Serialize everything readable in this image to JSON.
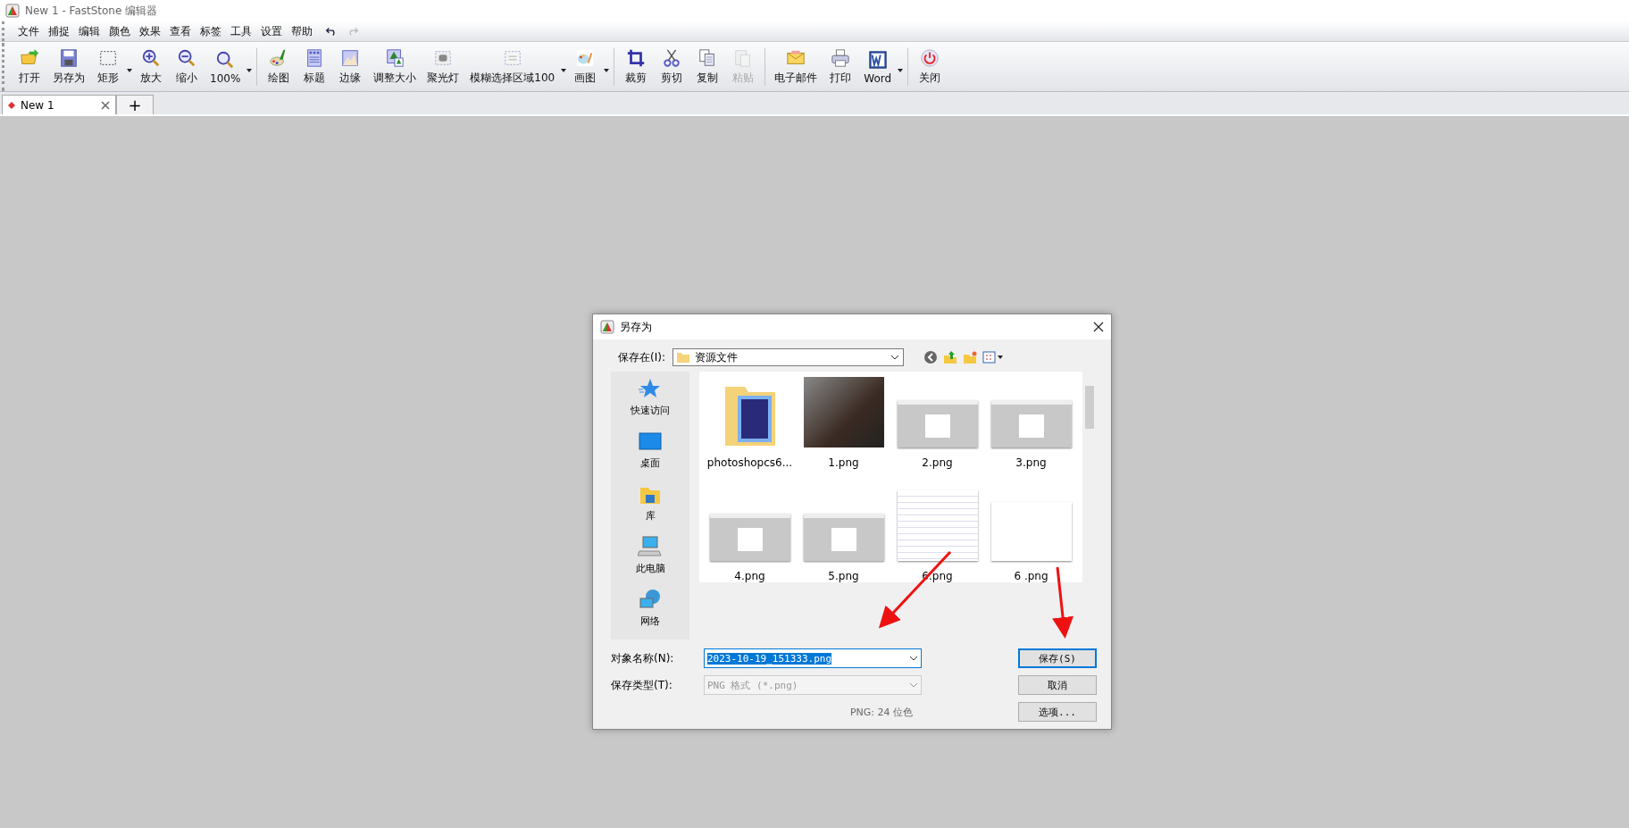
{
  "window": {
    "title": "New 1 - FastStone 编辑器"
  },
  "menu": [
    {
      "label": "文件"
    },
    {
      "label": "捕捉"
    },
    {
      "label": "编辑"
    },
    {
      "label": "颜色"
    },
    {
      "label": "效果"
    },
    {
      "label": "查看"
    },
    {
      "label": "标签"
    },
    {
      "label": "工具"
    },
    {
      "label": "设置"
    },
    {
      "label": "帮助"
    }
  ],
  "history": [
    {
      "kind": "undo",
      "disabled": false
    },
    {
      "kind": "redo",
      "disabled": true
    }
  ],
  "toolbar": [
    {
      "label": "打开",
      "dropdown": false,
      "disabled": false
    },
    {
      "label": "另存为",
      "dropdown": false,
      "disabled": false
    },
    {
      "label": "矩形",
      "dropdown": true,
      "disabled": false
    },
    {
      "label": "放大",
      "dropdown": false,
      "disabled": false
    },
    {
      "label": "缩小",
      "dropdown": false,
      "disabled": false
    },
    {
      "label": "100%",
      "dropdown": true,
      "disabled": false
    },
    {
      "label": "绘图",
      "dropdown": false,
      "disabled": false
    },
    {
      "label": "标题",
      "dropdown": false,
      "disabled": false
    },
    {
      "label": "边缘",
      "dropdown": false,
      "disabled": false
    },
    {
      "label": "调整大小",
      "dropdown": false,
      "disabled": false
    },
    {
      "label": "聚光灯",
      "dropdown": false,
      "disabled": false
    },
    {
      "label": "模糊选择区域100",
      "dropdown": true,
      "disabled": false
    },
    {
      "label": "画图",
      "dropdown": true,
      "disabled": false
    },
    {
      "label": "裁剪",
      "dropdown": false,
      "disabled": false
    },
    {
      "label": "剪切",
      "dropdown": false,
      "disabled": false
    },
    {
      "label": "复制",
      "dropdown": false,
      "disabled": false
    },
    {
      "label": "粘贴",
      "dropdown": false,
      "disabled": true
    },
    {
      "label": "电子邮件",
      "dropdown": false,
      "disabled": false
    },
    {
      "label": "打印",
      "dropdown": false,
      "disabled": false
    },
    {
      "label": "Word",
      "dropdown": true,
      "disabled": false
    },
    {
      "label": "关闭",
      "dropdown": false,
      "disabled": false
    }
  ],
  "tabs": [
    {
      "label": "New 1",
      "selected": true
    }
  ],
  "new_tab": "+",
  "dialog": {
    "title": "另存为",
    "save_in_label": "保存在(I):",
    "save_in_value": "资源文件",
    "places": [
      {
        "label": "快速访问"
      },
      {
        "label": "桌面"
      },
      {
        "label": "库"
      },
      {
        "label": "此电脑"
      },
      {
        "label": "网络"
      }
    ],
    "files": [
      {
        "name": "photoshopcs6...",
        "kind": "folder"
      },
      {
        "name": "1.png",
        "kind": "photo"
      },
      {
        "name": "2.png",
        "kind": "screen"
      },
      {
        "name": "3.png",
        "kind": "screen"
      },
      {
        "name": "4.png",
        "kind": "screen"
      },
      {
        "name": "5.png",
        "kind": "screen"
      },
      {
        "name": "6.png",
        "kind": "form"
      },
      {
        "name": "6 .png",
        "kind": "blank"
      }
    ],
    "filename_label": "对象名称(N):",
    "filename_value": "2023-10-19_151333.png",
    "type_label": "保存类型(T):",
    "type_value": "PNG 格式 (*.png)",
    "type_disabled": true,
    "save_button": "保存(S)",
    "cancel_button": "取消",
    "info": "PNG: 24 位色",
    "options_button": "选项..."
  }
}
